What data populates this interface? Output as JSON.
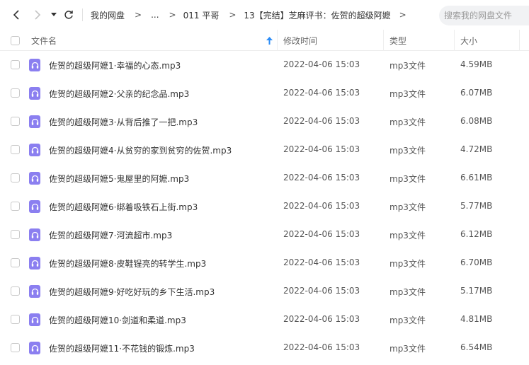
{
  "toolbar": {
    "breadcrumbs": [
      {
        "label": "我的网盘"
      },
      {
        "label": "..."
      },
      {
        "label": "011 平哥"
      },
      {
        "label": "13【完结】芝麻评书：佐贺的超级阿嬷"
      }
    ],
    "separator": ">",
    "search_placeholder": "搜索我的网盘文件"
  },
  "header": {
    "name": "文件名",
    "modified": "修改时间",
    "type": "类型",
    "size": "大小",
    "sort_icon": "arrow-up-icon"
  },
  "file_icon": "audio-file-icon",
  "accent_color": "#8b7ff0",
  "files": [
    {
      "name": "佐贺的超级阿嬷1·幸福的心态.mp3",
      "date": "2022-04-06 15:03",
      "type": "mp3文件",
      "size": "4.59MB"
    },
    {
      "name": "佐贺的超级阿嬷2·父亲的纪念品.mp3",
      "date": "2022-04-06 15:03",
      "type": "mp3文件",
      "size": "6.07MB"
    },
    {
      "name": "佐贺的超级阿嬷3·从背后推了一把.mp3",
      "date": "2022-04-06 15:03",
      "type": "mp3文件",
      "size": "6.08MB"
    },
    {
      "name": "佐贺的超级阿嬷4·从贫穷的家到贫穷的佐贺.mp3",
      "date": "2022-04-06 15:03",
      "type": "mp3文件",
      "size": "4.72MB"
    },
    {
      "name": "佐贺的超级阿嬷5·鬼屋里的阿嬷.mp3",
      "date": "2022-04-06 15:03",
      "type": "mp3文件",
      "size": "6.61MB"
    },
    {
      "name": "佐贺的超级阿嬷6·绑着吸铁石上街.mp3",
      "date": "2022-04-06 15:03",
      "type": "mp3文件",
      "size": "5.77MB"
    },
    {
      "name": "佐贺的超级阿嬷7·河流超市.mp3",
      "date": "2022-04-06 15:03",
      "type": "mp3文件",
      "size": "6.12MB"
    },
    {
      "name": "佐贺的超级阿嬷8·皮鞋锃亮的转学生.mp3",
      "date": "2022-04-06 15:03",
      "type": "mp3文件",
      "size": "6.70MB"
    },
    {
      "name": "佐贺的超级阿嬷9·好吃好玩的乡下生活.mp3",
      "date": "2022-04-06 15:03",
      "type": "mp3文件",
      "size": "5.17MB"
    },
    {
      "name": "佐贺的超级阿嬷10·剑道和柔道.mp3",
      "date": "2022-04-06 15:03",
      "type": "mp3文件",
      "size": "4.81MB"
    },
    {
      "name": "佐贺的超级阿嬷11·不花钱的锻炼.mp3",
      "date": "2022-04-06 15:03",
      "type": "mp3文件",
      "size": "6.54MB"
    }
  ]
}
